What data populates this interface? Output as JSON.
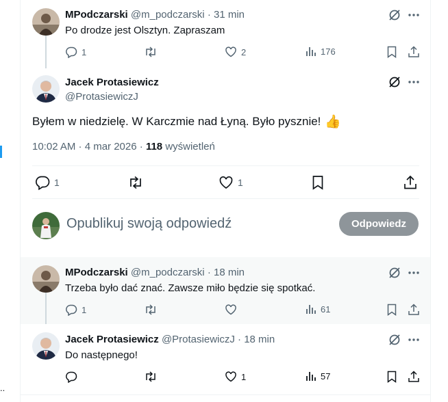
{
  "replies": [
    {
      "name": "MPodczarski",
      "handle": "@m_podczarski",
      "time": "31 min",
      "text": "Po drodze jest Olsztyn. Zapraszam",
      "reply_count": "1",
      "like_count": "2",
      "view_count": "176"
    },
    {
      "name": "MPodczarski",
      "handle": "@m_podczarski",
      "time": "18 min",
      "text": "Trzeba było dać znać. Zawsze miło będzie się spotkać.",
      "reply_count": "1",
      "like_count": "",
      "view_count": "61"
    },
    {
      "name": "Jacek Protasiewicz",
      "handle": "@ProtasiewiczJ",
      "time": "18 min",
      "text": "Do następnego!",
      "reply_count": "",
      "like_count": "1",
      "view_count": "57"
    }
  ],
  "main_post": {
    "name": "Jacek Protasiewicz",
    "handle": "@ProtasiewiczJ",
    "text": "Byłem w niedzielę. W Karczmie nad Łyną. Było pysznie!",
    "emoji": "👍",
    "timestamp": "10:02 AM · 4 mar 2026",
    "views_count": "118",
    "views_label": "wyświetleń",
    "reply_count": "1",
    "like_count": "1"
  },
  "composer": {
    "placeholder": "Opublikuj swoją odpowiedź",
    "button_label": "Odpowiedz"
  },
  "separator_dot": "·",
  "left_edge_text": "..",
  "colors": {
    "accent": "#1d9bf0",
    "muted_text": "#536471",
    "button_disabled": "#8e959a",
    "highlight_bg": "#f7f9f9"
  }
}
